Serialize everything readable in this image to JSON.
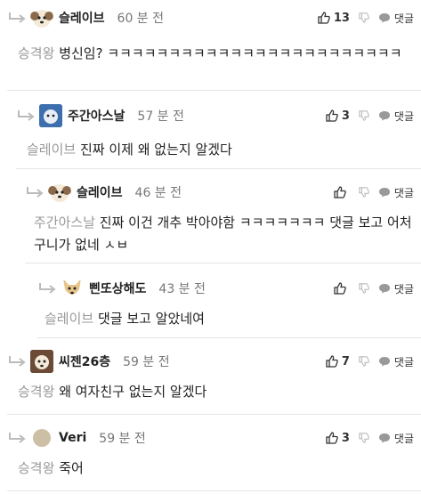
{
  "comments": [
    {
      "nick": "슬레이브",
      "time": "60 분 전",
      "likes": "13",
      "reply_label": "댓글",
      "mention": "승격왕",
      "text": "병신임? ㅋㅋㅋㅋㅋㅋㅋㅋㅋㅋㅋㅋㅋㅋㅋㅋㅋㅋㅋㅋㅋㅋㅋㅋ"
    },
    {
      "nick": "주간아스날",
      "time": "57 분 전",
      "likes": "3",
      "reply_label": "댓글",
      "mention": "슬레이브",
      "text": "진짜 이제 왜 없는지 알겠다"
    },
    {
      "nick": "슬레이브",
      "time": "46 분 전",
      "likes": "",
      "reply_label": "댓글",
      "mention": "주간아스날",
      "text": "진짜 이건 개추 박아야함 ㅋㅋㅋㅋㅋㅋㅋ 댓글 보고 어처구니가 없네 ㅅㅂ"
    },
    {
      "nick": "삔또상해도",
      "time": "43 분 전",
      "likes": "",
      "reply_label": "댓글",
      "mention": "슬레이브",
      "text": "댓글 보고 알았네여"
    },
    {
      "nick": "씨젠26층",
      "time": "59 분 전",
      "likes": "7",
      "reply_label": "댓글",
      "mention": "승격왕",
      "text": "왜 여자친구 없는지 알겠다"
    },
    {
      "nick": "Veri",
      "time": "59 분 전",
      "likes": "3",
      "reply_label": "댓글",
      "mention": "승격왕",
      "text": "죽어"
    }
  ]
}
